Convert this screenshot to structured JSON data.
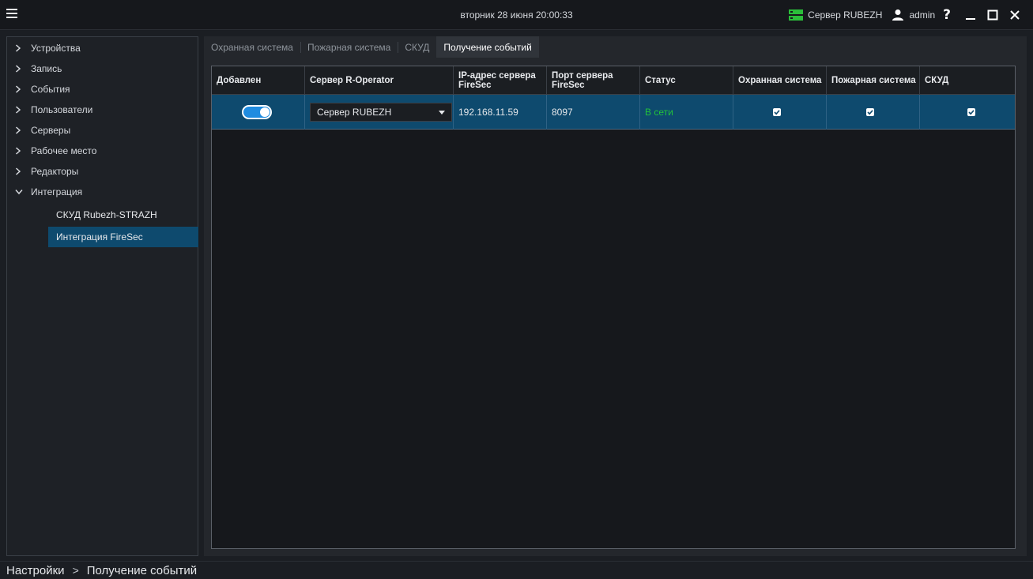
{
  "titlebar": {
    "datetime": "вторник 28 июня 20:00:33",
    "server_label": "Сервер RUBEZH",
    "user_label": "admin",
    "help_label": "?"
  },
  "sidebar": {
    "items": [
      {
        "label": "Устройства",
        "icon": "chevron-right-icon"
      },
      {
        "label": "Запись",
        "icon": "chevron-right-icon"
      },
      {
        "label": "События",
        "icon": "chevron-right-icon"
      },
      {
        "label": "Пользователи",
        "icon": "chevron-right-icon"
      },
      {
        "label": "Серверы",
        "icon": "chevron-right-icon"
      },
      {
        "label": "Рабочее место",
        "icon": "chevron-right-icon"
      },
      {
        "label": "Редакторы",
        "icon": "chevron-right-icon"
      },
      {
        "label": "Интеграция",
        "icon": "chevron-down-icon"
      }
    ],
    "subitems": [
      {
        "label": "СКУД Rubezh-STRAZH",
        "active": false
      },
      {
        "label": "Интеграция FireSec",
        "active": true
      }
    ]
  },
  "tabs": [
    {
      "label": "Охранная система",
      "active": false
    },
    {
      "label": "Пожарная система",
      "active": false
    },
    {
      "label": "СКУД",
      "active": false
    },
    {
      "label": "Получение событий",
      "active": true
    }
  ],
  "table": {
    "headers": [
      "Добавлен",
      "Сервер R-Operator",
      "IP-адрес сервера FireSec",
      "Порт сервера FireSec",
      "Статус",
      "Охранная система",
      "Пожарная система",
      "СКУД"
    ],
    "rows": [
      {
        "added": true,
        "server": "Сервер RUBEZH",
        "ip": "192.168.11.59",
        "port": "8097",
        "status": "В сети",
        "security": true,
        "fire": true,
        "access": true
      }
    ]
  },
  "breadcrumb": {
    "root": "Настройки",
    "separator": ">",
    "current": "Получение событий"
  },
  "colors": {
    "accent_selection": "#0e4a6e",
    "toggle_on": "#1f8ce0",
    "status_online": "#22c33a",
    "server_icon": "#2bbd3a"
  }
}
